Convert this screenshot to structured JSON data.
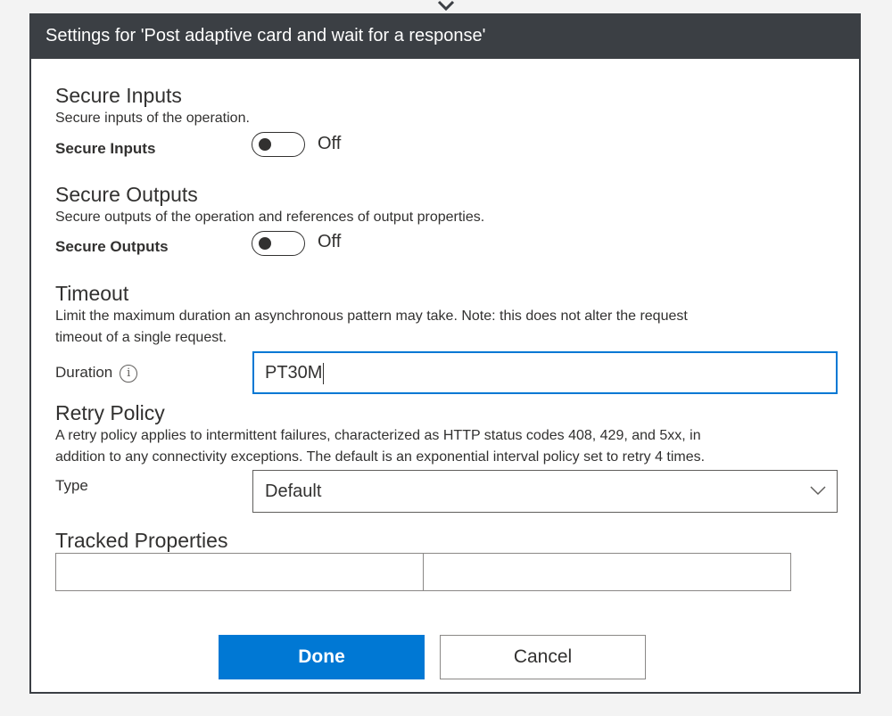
{
  "dialog": {
    "title": "Settings for 'Post adaptive card and wait for a response'"
  },
  "secure_inputs": {
    "title": "Secure Inputs",
    "description": "Secure inputs of the operation.",
    "label": "Secure Inputs",
    "state": "Off"
  },
  "secure_outputs": {
    "title": "Secure Outputs",
    "description": "Secure outputs of the operation and references of output properties.",
    "label": "Secure Outputs",
    "state": "Off"
  },
  "timeout": {
    "title": "Timeout",
    "description_line1": "Limit the maximum duration an asynchronous pattern may take. Note: this does not alter the request",
    "description_line2": "timeout of a single request.",
    "label": "Duration",
    "value": "PT30M"
  },
  "retry_policy": {
    "title": "Retry Policy",
    "description_line1": "A retry policy applies to intermittent failures, characterized as HTTP status codes 408, 429, and 5xx, in",
    "description_line2": "addition to any connectivity exceptions. The default is an exponential interval policy set to retry 4 times.",
    "label": "Type",
    "selected": "Default"
  },
  "tracked_properties": {
    "title": "Tracked Properties"
  },
  "buttons": {
    "done": "Done",
    "cancel": "Cancel"
  },
  "colors": {
    "header_bg": "#3b3f44",
    "accent": "#0078d4"
  }
}
